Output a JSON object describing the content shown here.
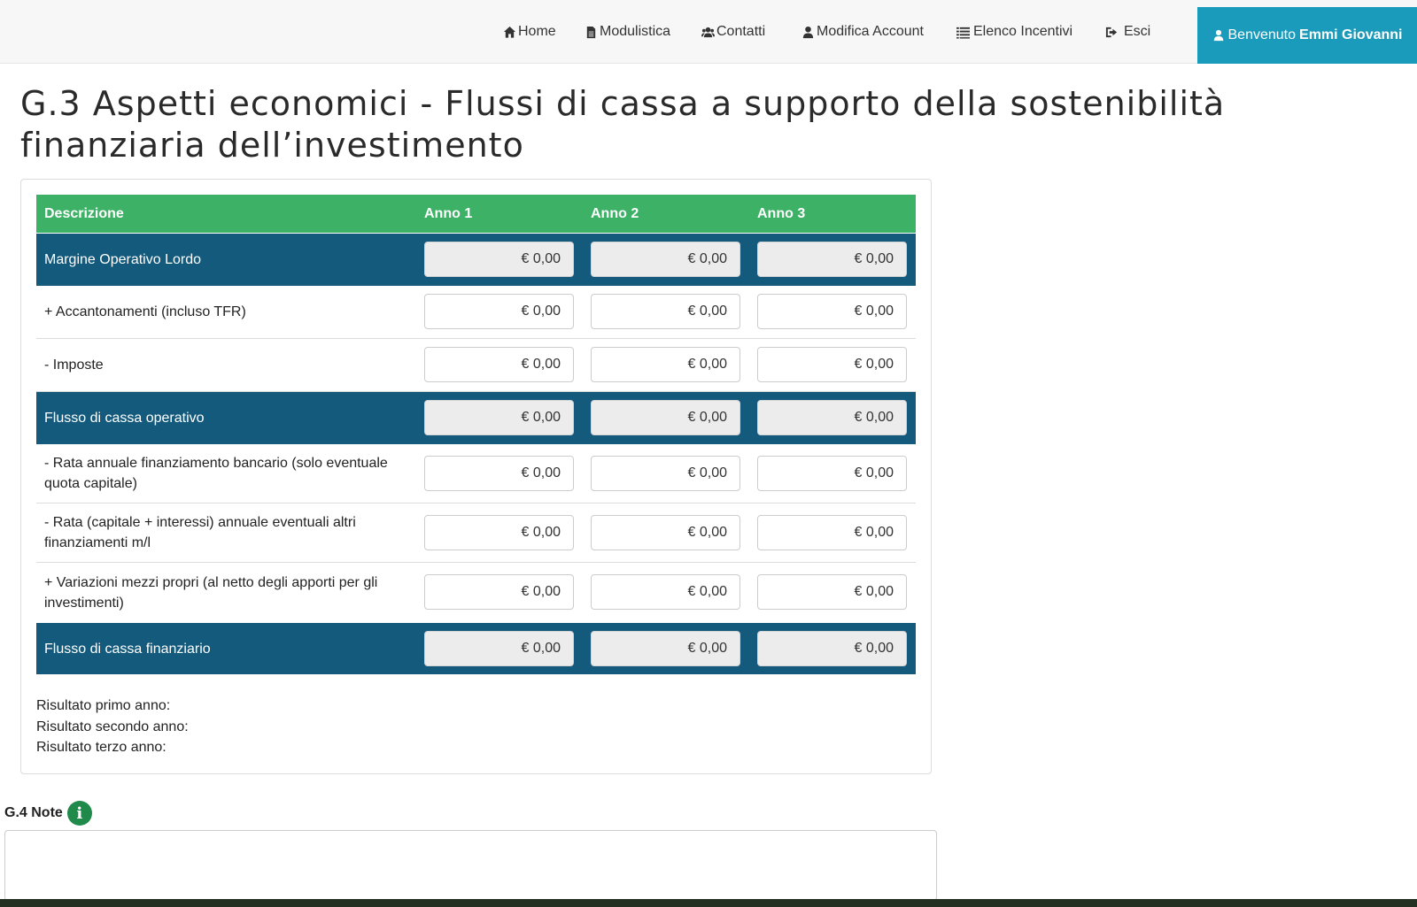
{
  "nav": {
    "items": [
      {
        "label": "Home",
        "icon": "home-icon"
      },
      {
        "label": "Modulistica",
        "icon": "file-icon"
      },
      {
        "label": "Contatti",
        "icon": "users-icon"
      },
      {
        "label": "Modifica Account",
        "icon": "user-icon"
      },
      {
        "label": "Elenco Incentivi",
        "icon": "list-icon"
      },
      {
        "label": "Esci",
        "icon": "sign-out-icon"
      }
    ],
    "welcome_prefix": "Benvenuto",
    "welcome_name": "Emmi Giovanni",
    "welcome_color": "#1a9bbb"
  },
  "page_title": "G.3 Aspetti economici - Flussi di cassa a supporto della sostenibilità finanziaria dell’investimento",
  "table": {
    "header_color": "#3db165",
    "total_color": "#135a7c",
    "columns": [
      "Descrizione",
      "Anno 1",
      "Anno 2",
      "Anno 3"
    ],
    "rows": [
      {
        "label": "Margine Operativo Lordo",
        "type": "total",
        "values": [
          "€ 0,00",
          "€ 0,00",
          "€ 0,00"
        ]
      },
      {
        "label": "+ Accantonamenti (incluso TFR)",
        "type": "plain",
        "values": [
          "€ 0,00",
          "€ 0,00",
          "€ 0,00"
        ]
      },
      {
        "label": "- Imposte",
        "type": "plain",
        "values": [
          "€ 0,00",
          "€ 0,00",
          "€ 0,00"
        ]
      },
      {
        "label": "Flusso di cassa operativo",
        "type": "total",
        "values": [
          "€ 0,00",
          "€ 0,00",
          "€ 0,00"
        ]
      },
      {
        "label": "- Rata annuale finanziamento bancario (solo eventuale quota capitale)",
        "type": "plain",
        "values": [
          "€ 0,00",
          "€ 0,00",
          "€ 0,00"
        ]
      },
      {
        "label": "- Rata (capitale + interessi) annuale eventuali altri finanziamenti m/l",
        "type": "plain",
        "values": [
          "€ 0,00",
          "€ 0,00",
          "€ 0,00"
        ]
      },
      {
        "label": "+ Variazioni mezzi propri (al netto degli apporti per gli investimenti)",
        "type": "plain",
        "values": [
          "€ 0,00",
          "€ 0,00",
          "€ 0,00"
        ]
      },
      {
        "label": "Flusso di cassa finanziario",
        "type": "total",
        "values": [
          "€ 0,00",
          "€ 0,00",
          "€ 0,00"
        ]
      }
    ]
  },
  "results": {
    "first": "Risultato primo anno:",
    "second": "Risultato secondo anno:",
    "third": "Risultato terzo anno:"
  },
  "notes": {
    "label": "G.4 Note",
    "icon": "info-icon",
    "value": ""
  }
}
